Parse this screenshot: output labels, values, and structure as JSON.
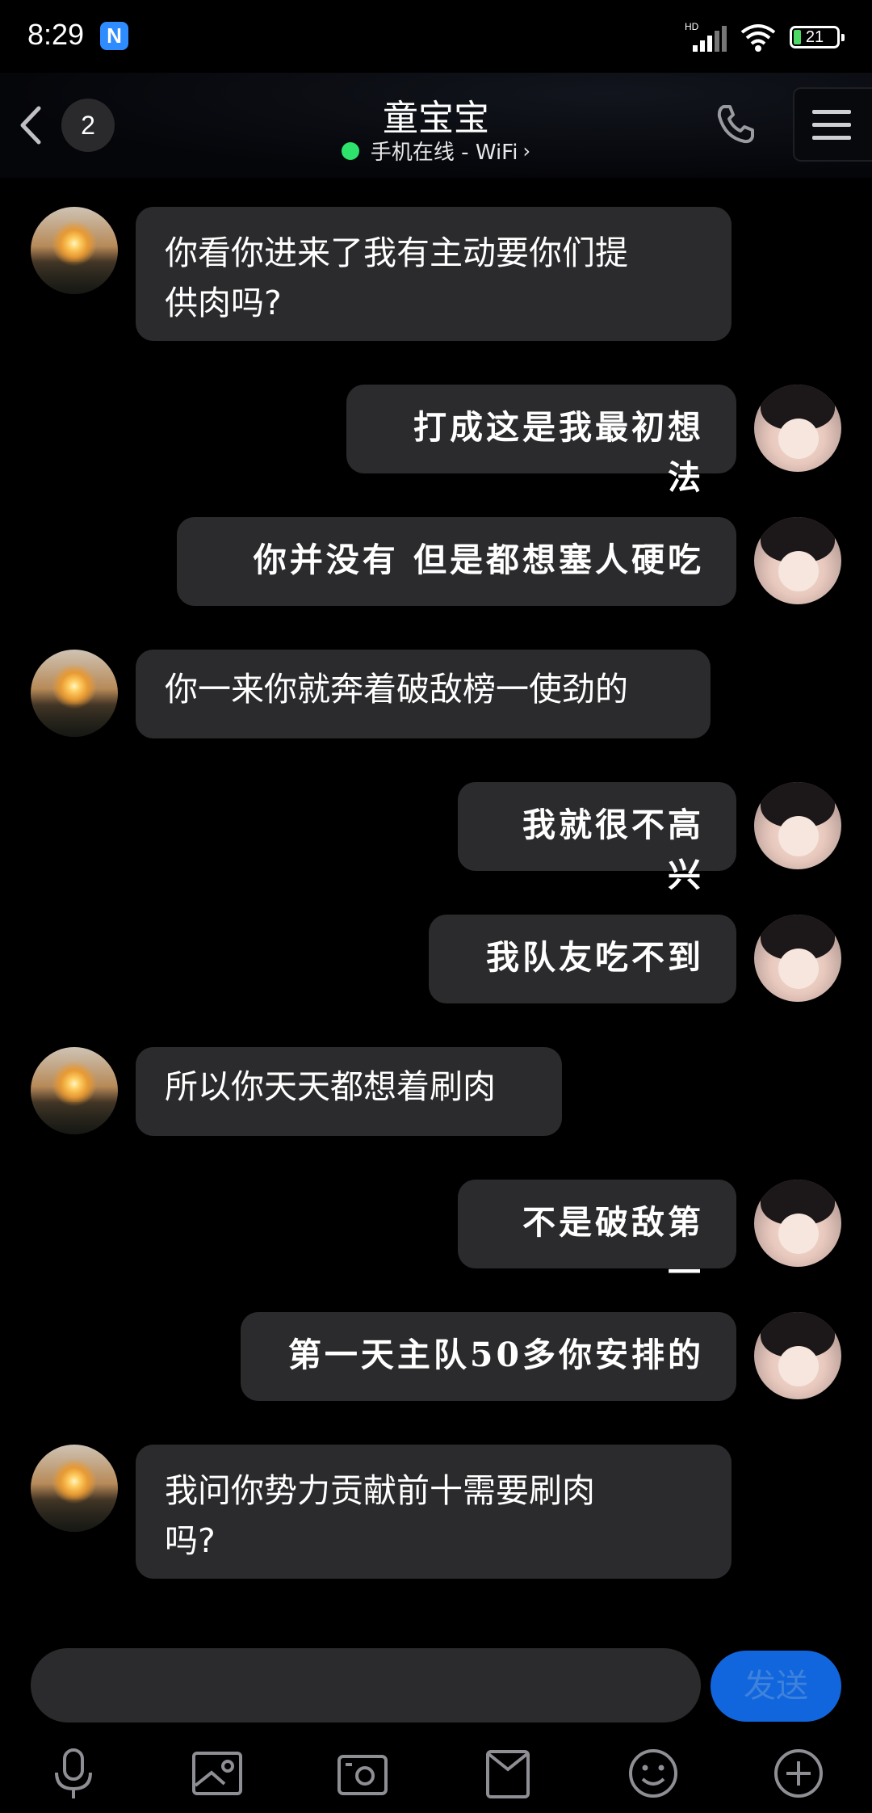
{
  "status_bar": {
    "time": "8:29",
    "app_badge": "N",
    "network": "HD",
    "battery": "21"
  },
  "header": {
    "unread_count": "2",
    "contact_name": "童宝宝",
    "status_text": "手机在线 - WiFi"
  },
  "messages": [
    {
      "side": "them",
      "text": "你看你进来了我有主动要你们提\n供肉吗?"
    },
    {
      "side": "me",
      "text": "打成这是我最初想法"
    },
    {
      "side": "me",
      "text": "你并没有 但是都想塞人硬吃"
    },
    {
      "side": "them",
      "text": "你一来你就奔着破敌榜一使劲的"
    },
    {
      "side": "me",
      "text": "我就很不高兴"
    },
    {
      "side": "me",
      "text": "我队友吃不到"
    },
    {
      "side": "them",
      "text": "所以你天天都想着刷肉"
    },
    {
      "side": "me",
      "text": "不是破敌第一"
    },
    {
      "side": "me",
      "text": "第一天主队50多你安排的"
    },
    {
      "side": "them",
      "text": "我问你势力贡献前十需要刷肉\n吗?"
    }
  ],
  "input": {
    "value": "",
    "placeholder": ""
  },
  "send_label": "发送",
  "toolbar": [
    "microphone-icon",
    "photo-icon",
    "camera-icon",
    "file-icon",
    "emoji-icon",
    "plus-icon"
  ],
  "colors": {
    "background": "#000000",
    "bubble": "#2b2b2d",
    "send_button": "#1166dd",
    "online_dot": "#2ee36b"
  }
}
